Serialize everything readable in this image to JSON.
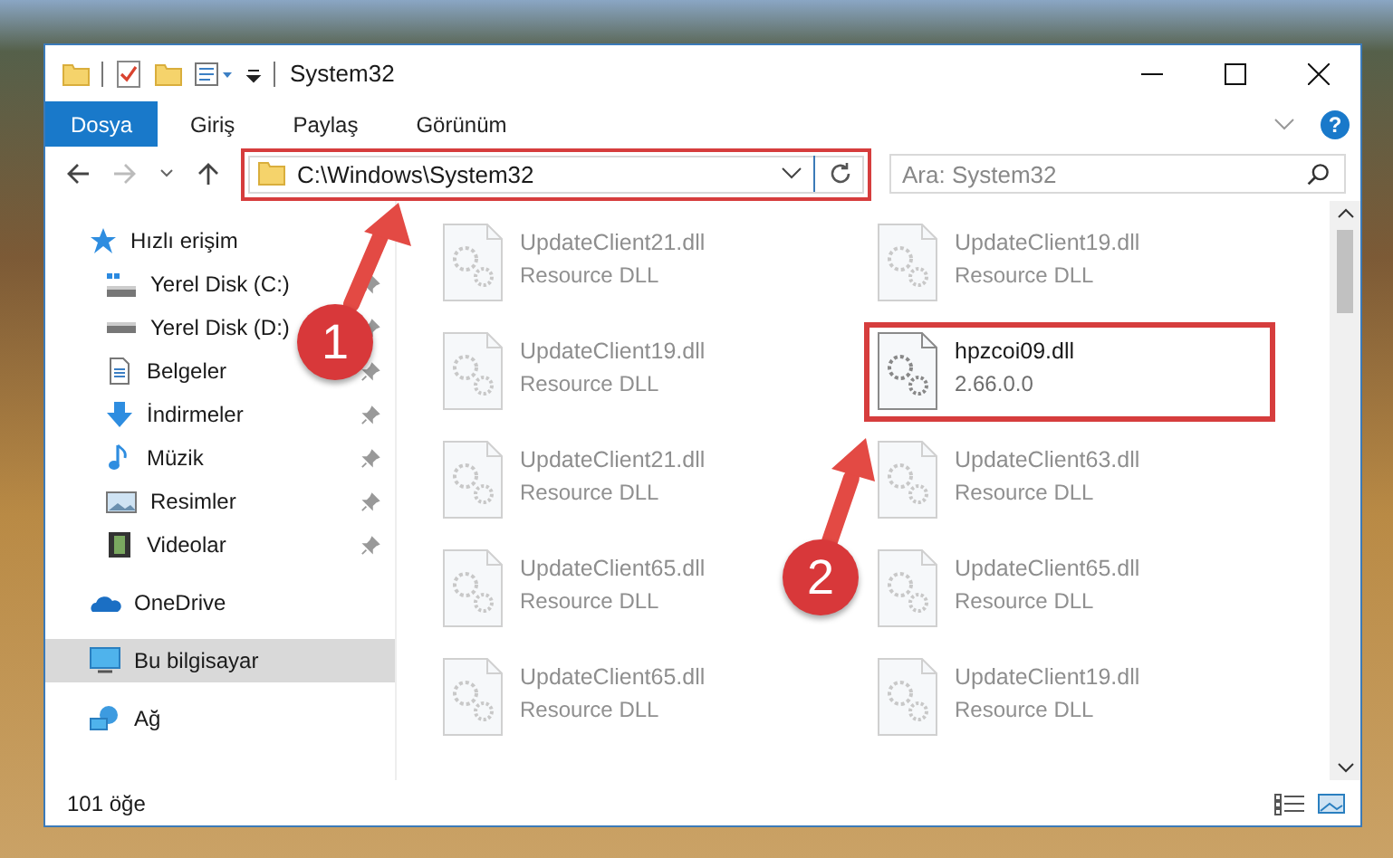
{
  "window": {
    "title": "System32"
  },
  "ribbon": {
    "tabs": [
      {
        "label": "Dosya",
        "selected": true
      },
      {
        "label": "Giriş",
        "selected": false
      },
      {
        "label": "Paylaş",
        "selected": false
      },
      {
        "label": "Görünüm",
        "selected": false
      }
    ],
    "help": "?"
  },
  "address": {
    "path": "C:\\Windows\\System32",
    "highlighted": true
  },
  "search": {
    "placeholder": "Ara: System32"
  },
  "sidebar": {
    "items": [
      {
        "label": "Hızlı erişim",
        "kind": "star",
        "selected": false,
        "children": [
          {
            "label": "Yerel Disk (C:)",
            "kind": "system-drive",
            "pinned": true,
            "selected": false
          },
          {
            "label": "Yerel Disk (D:)",
            "kind": "drive",
            "pinned": true,
            "selected": false
          },
          {
            "label": "Belgeler",
            "kind": "document",
            "pinned": true,
            "selected": false
          },
          {
            "label": "İndirmeler",
            "kind": "download",
            "pinned": true,
            "selected": false
          },
          {
            "label": "Müzik",
            "kind": "music",
            "pinned": true,
            "selected": false
          },
          {
            "label": "Resimler",
            "kind": "pictures",
            "pinned": true,
            "selected": false
          },
          {
            "label": "Videolar",
            "kind": "video",
            "pinned": true,
            "selected": false
          }
        ]
      },
      {
        "label": "OneDrive",
        "kind": "cloud",
        "selected": false
      },
      {
        "label": "Bu bilgisayar",
        "kind": "computer",
        "selected": true
      },
      {
        "label": "Ağ",
        "kind": "network",
        "selected": false
      }
    ]
  },
  "files": [
    {
      "name": "UpdateClient21.dll",
      "detail": "Resource DLL",
      "faded": true,
      "highlighted": false
    },
    {
      "name": "UpdateClient19.dll",
      "detail": "Resource DLL",
      "faded": true,
      "highlighted": false
    },
    {
      "name": "UpdateClient19.dll",
      "detail": "Resource DLL",
      "faded": true,
      "highlighted": false
    },
    {
      "name": "hpzcoi09.dll",
      "detail": "2.66.0.0",
      "faded": false,
      "highlighted": true
    },
    {
      "name": "UpdateClient21.dll",
      "detail": "Resource DLL",
      "faded": true,
      "highlighted": false
    },
    {
      "name": "UpdateClient63.dll",
      "detail": "Resource DLL",
      "faded": true,
      "highlighted": false
    },
    {
      "name": "UpdateClient65.dll",
      "detail": "Resource DLL",
      "faded": true,
      "highlighted": false
    },
    {
      "name": "UpdateClient65.dll",
      "detail": "Resource DLL",
      "faded": true,
      "highlighted": false
    },
    {
      "name": "UpdateClient65.dll",
      "detail": "Resource DLL",
      "faded": true,
      "highlighted": false
    },
    {
      "name": "UpdateClient19.dll",
      "detail": "Resource DLL",
      "faded": true,
      "highlighted": false
    }
  ],
  "status_bar": {
    "count": "101 öğe"
  },
  "callouts": [
    {
      "label": "1"
    },
    {
      "label": "2"
    }
  ]
}
